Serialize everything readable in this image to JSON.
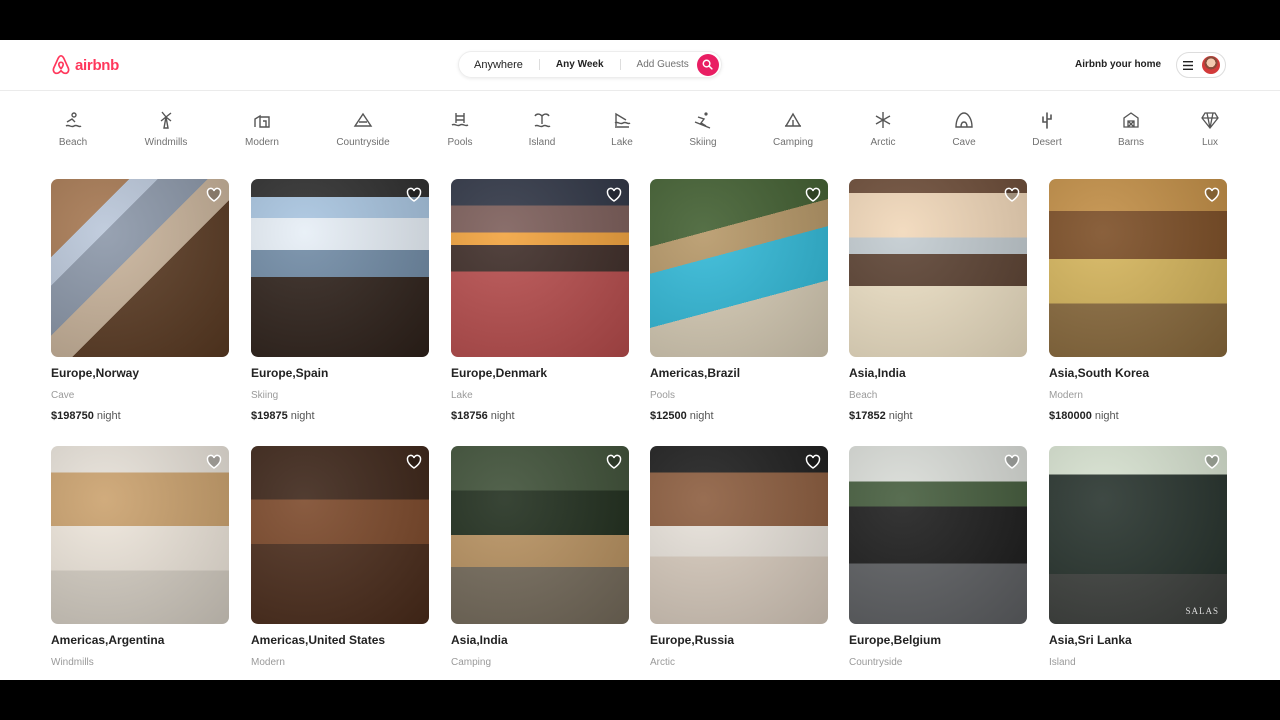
{
  "header": {
    "logo_text": "airbnb",
    "search": {
      "where": "Anywhere",
      "when": "Any Week",
      "who": "Add Guests"
    },
    "host_link": "Airbnb your home"
  },
  "categories": [
    {
      "label": "Beach",
      "icon": "beach-icon"
    },
    {
      "label": "Windmills",
      "icon": "windmill-icon"
    },
    {
      "label": "Modern",
      "icon": "modern-house-icon"
    },
    {
      "label": "Countryside",
      "icon": "countryside-icon"
    },
    {
      "label": "Pools",
      "icon": "pool-icon"
    },
    {
      "label": "Island",
      "icon": "island-icon"
    },
    {
      "label": "Lake",
      "icon": "lake-icon"
    },
    {
      "label": "Skiing",
      "icon": "skiing-icon"
    },
    {
      "label": "Camping",
      "icon": "camping-icon"
    },
    {
      "label": "Arctic",
      "icon": "snowflake-icon"
    },
    {
      "label": "Cave",
      "icon": "cave-icon"
    },
    {
      "label": "Desert",
      "icon": "cactus-icon"
    },
    {
      "label": "Barns",
      "icon": "barn-icon"
    },
    {
      "label": "Lux",
      "icon": "diamond-icon"
    }
  ],
  "listings": [
    {
      "location": "Europe,Norway",
      "category": "Cave",
      "price": "$198750",
      "unit": "night"
    },
    {
      "location": "Europe,Spain",
      "category": "Skiing",
      "price": "$19875",
      "unit": "night"
    },
    {
      "location": "Europe,Denmark",
      "category": "Lake",
      "price": "$18756",
      "unit": "night"
    },
    {
      "location": "Americas,Brazil",
      "category": "Pools",
      "price": "$12500",
      "unit": "night"
    },
    {
      "location": "Asia,India",
      "category": "Beach",
      "price": "$17852",
      "unit": "night"
    },
    {
      "location": "Asia,South Korea",
      "category": "Modern",
      "price": "$180000",
      "unit": "night"
    },
    {
      "location": "Americas,Argentina",
      "category": "Windmills"
    },
    {
      "location": "Americas,United States",
      "category": "Modern"
    },
    {
      "location": "Asia,India",
      "category": "Camping"
    },
    {
      "location": "Europe,Russia",
      "category": "Arctic"
    },
    {
      "location": "Europe,Belgium",
      "category": "Countryside"
    },
    {
      "location": "Asia,Sri Lanka",
      "category": "Island",
      "watermark": "SALAS"
    }
  ],
  "colors": {
    "brand": "#ff385c",
    "search_button": "#e91e63"
  }
}
